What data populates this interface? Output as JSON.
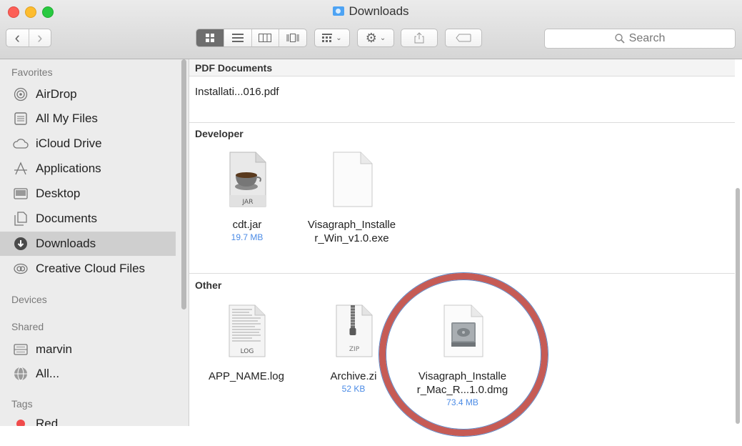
{
  "window": {
    "title": "Downloads"
  },
  "toolbar": {
    "back_label": "‹",
    "forward_label": "›",
    "search_placeholder": "Search"
  },
  "sidebar": {
    "favorites_label": "Favorites",
    "favorites": [
      {
        "label": "AirDrop",
        "icon": "airdrop-icon"
      },
      {
        "label": "All My Files",
        "icon": "all-files-icon"
      },
      {
        "label": "iCloud Drive",
        "icon": "cloud-icon"
      },
      {
        "label": "Applications",
        "icon": "applications-icon"
      },
      {
        "label": "Desktop",
        "icon": "desktop-icon"
      },
      {
        "label": "Documents",
        "icon": "documents-icon"
      },
      {
        "label": "Downloads",
        "icon": "downloads-icon",
        "selected": true
      },
      {
        "label": "Creative Cloud Files",
        "icon": "creative-cloud-icon"
      }
    ],
    "devices_label": "Devices",
    "shared_label": "Shared",
    "shared": [
      {
        "label": "marvin",
        "icon": "server-icon"
      },
      {
        "label": "All...",
        "icon": "network-icon"
      }
    ],
    "tags_label": "Tags",
    "tags": [
      {
        "label": "Red",
        "color": "#f04b4b"
      }
    ]
  },
  "content": {
    "groups": [
      {
        "label": "PDF Documents",
        "files": [
          {
            "name": "Installati...016.pdf",
            "size": ""
          }
        ]
      },
      {
        "label": "Developer",
        "files": [
          {
            "name": "cdt.jar",
            "size": "19.7 MB",
            "icon": "jar-file-icon",
            "badge": "JAR"
          },
          {
            "name": "Visagraph_Installer_Win_v1.0.exe",
            "name_line1": "Visagraph_Installe",
            "name_line2": "r_Win_v1.0.exe",
            "size": "",
            "icon": "blank-file-icon"
          }
        ]
      },
      {
        "label": "Other",
        "files": [
          {
            "name": "APP_NAME.log",
            "size": "",
            "icon": "log-file-icon",
            "badge": "LOG"
          },
          {
            "name": "Archive.zip",
            "name_visible": "Archive.zi",
            "size": "52 KB",
            "icon": "zip-file-icon",
            "badge": "ZIP"
          },
          {
            "name_line1": "Visagraph_Installe",
            "name_line2": "r_Mac_R...1.0.dmg",
            "size": "73.4 MB",
            "icon": "dmg-file-icon"
          }
        ]
      }
    ]
  },
  "colors": {
    "highlight_ring": "#c65b55",
    "size_text": "#4b8be6",
    "selected_row": "#cfcfcf"
  }
}
